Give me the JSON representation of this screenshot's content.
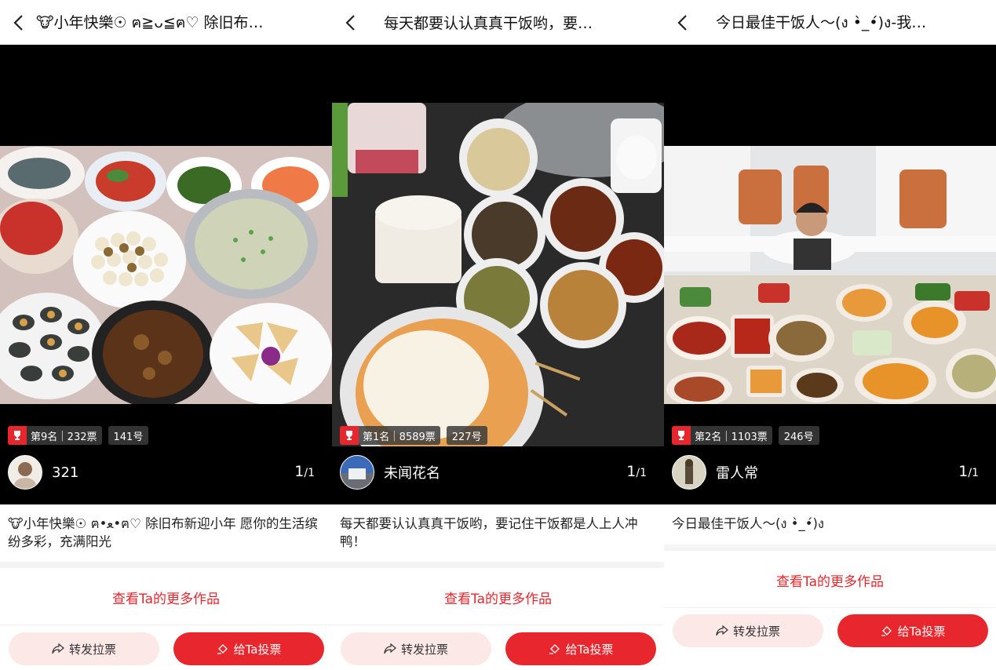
{
  "panels": [
    {
      "title": "🐮小年快樂☉ ฅ≧ᴗ≦ฅ♡ 除旧布…",
      "rank_label": "第9名",
      "votes": "232票",
      "number": "141号",
      "author": "321",
      "page_current": "1",
      "page_total": "/1",
      "description": "🐮小年快樂☉ ฅ•ﻌ•ฅ♡ 除旧布新迎小年 愿你的生活缤纷多彩，充满阳光",
      "more_link": "查看Ta的更多作品",
      "share_label": "转发拉票",
      "vote_label": "给Ta投票"
    },
    {
      "title": "每天都要认认真真干饭哟，要…",
      "rank_label": "第1名",
      "votes": "8589票",
      "number": "227号",
      "author": "未闻花名",
      "page_current": "1",
      "page_total": "/1",
      "description": "每天都要认认真真干饭哟，要记住干饭都是人上人冲鸭！",
      "more_link": "查看Ta的更多作品",
      "share_label": "转发拉票",
      "vote_label": "给Ta投票"
    },
    {
      "title": "今日最佳干饭人～(ง •̀_•́)ง-我…",
      "rank_label": "第2名",
      "votes": "1103票",
      "number": "246号",
      "author": "雷人常",
      "page_current": "1",
      "page_total": "/1",
      "description": "今日最佳干饭人～(ง •̀_•́)ง",
      "more_link": "查看Ta的更多作品",
      "share_label": "转发拉票",
      "vote_label": "给Ta投票"
    }
  ],
  "colors": {
    "accent": "#e8262d",
    "share_bg": "#fde8e8",
    "media_bg": "#000000"
  }
}
